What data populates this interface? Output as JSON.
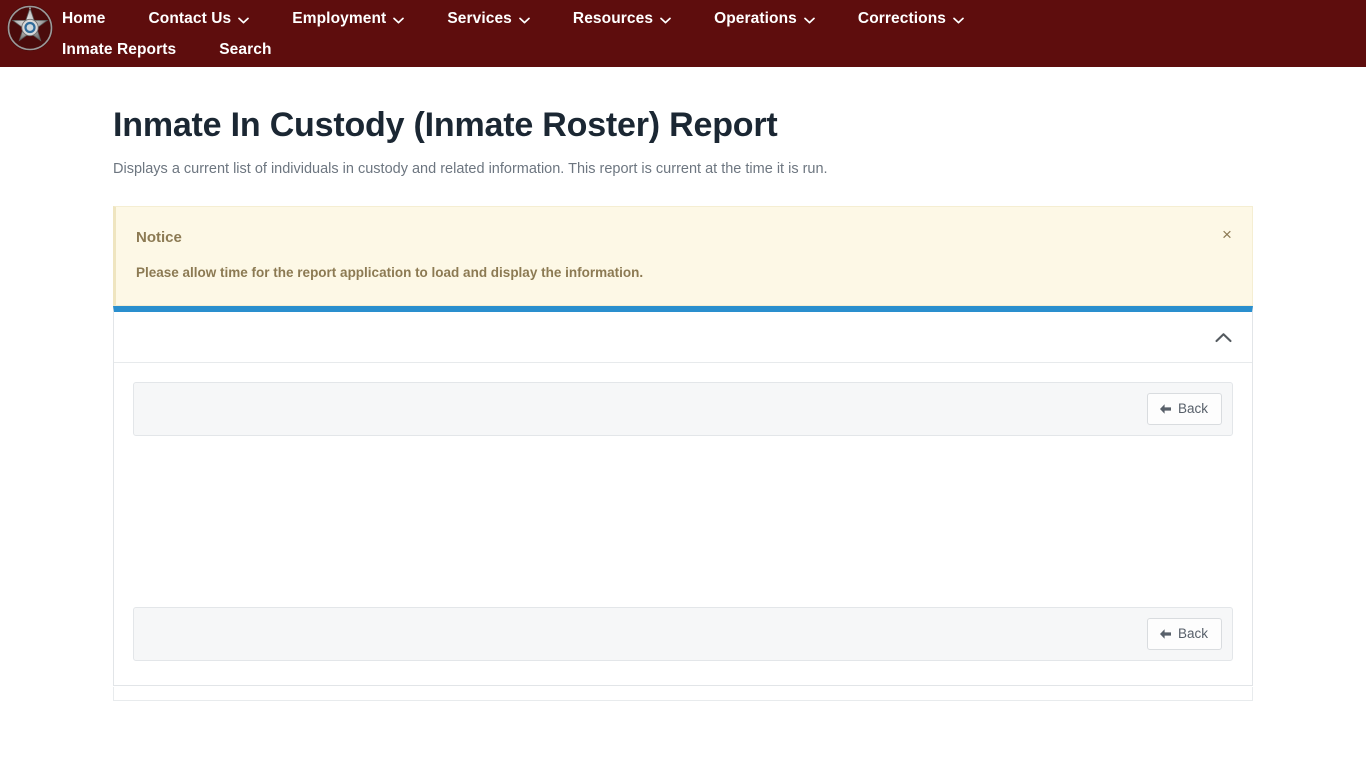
{
  "site": {
    "logo_alt": "Sheriff's Office star badge"
  },
  "navbar": {
    "background": "#5e0d0d",
    "rows": [
      [
        {
          "label": "Home",
          "has_caret": false
        },
        {
          "label": "Contact Us",
          "has_caret": true
        },
        {
          "label": "Employment",
          "has_caret": true
        },
        {
          "label": "Services",
          "has_caret": true
        },
        {
          "label": "Resources",
          "has_caret": true
        },
        {
          "label": "Operations",
          "has_caret": true
        },
        {
          "label": "Corrections",
          "has_caret": true
        }
      ],
      [
        {
          "label": "Inmate Reports",
          "has_caret": false
        },
        {
          "label": "Search",
          "has_caret": false
        }
      ]
    ]
  },
  "page": {
    "title": "Inmate In Custody (Inmate Roster) Report",
    "subtitle": "Displays a current list of individuals in custody and related information. This report is current at the time it is run."
  },
  "notice": {
    "title": "Notice",
    "text": "Please allow time for the report application to load and display the information.",
    "close_label": "×",
    "background": "#fdf8e6",
    "text_color": "#8c7a53"
  },
  "report_card": {
    "accent_color": "#2a8fce",
    "collapse_icon": "chevron-up-icon",
    "top_toolbar": {
      "back_button": {
        "label": "Back",
        "icon": "arrow-left-icon"
      }
    },
    "bottom_toolbar": {
      "back_button": {
        "label": "Back",
        "icon": "arrow-left-icon"
      }
    }
  }
}
